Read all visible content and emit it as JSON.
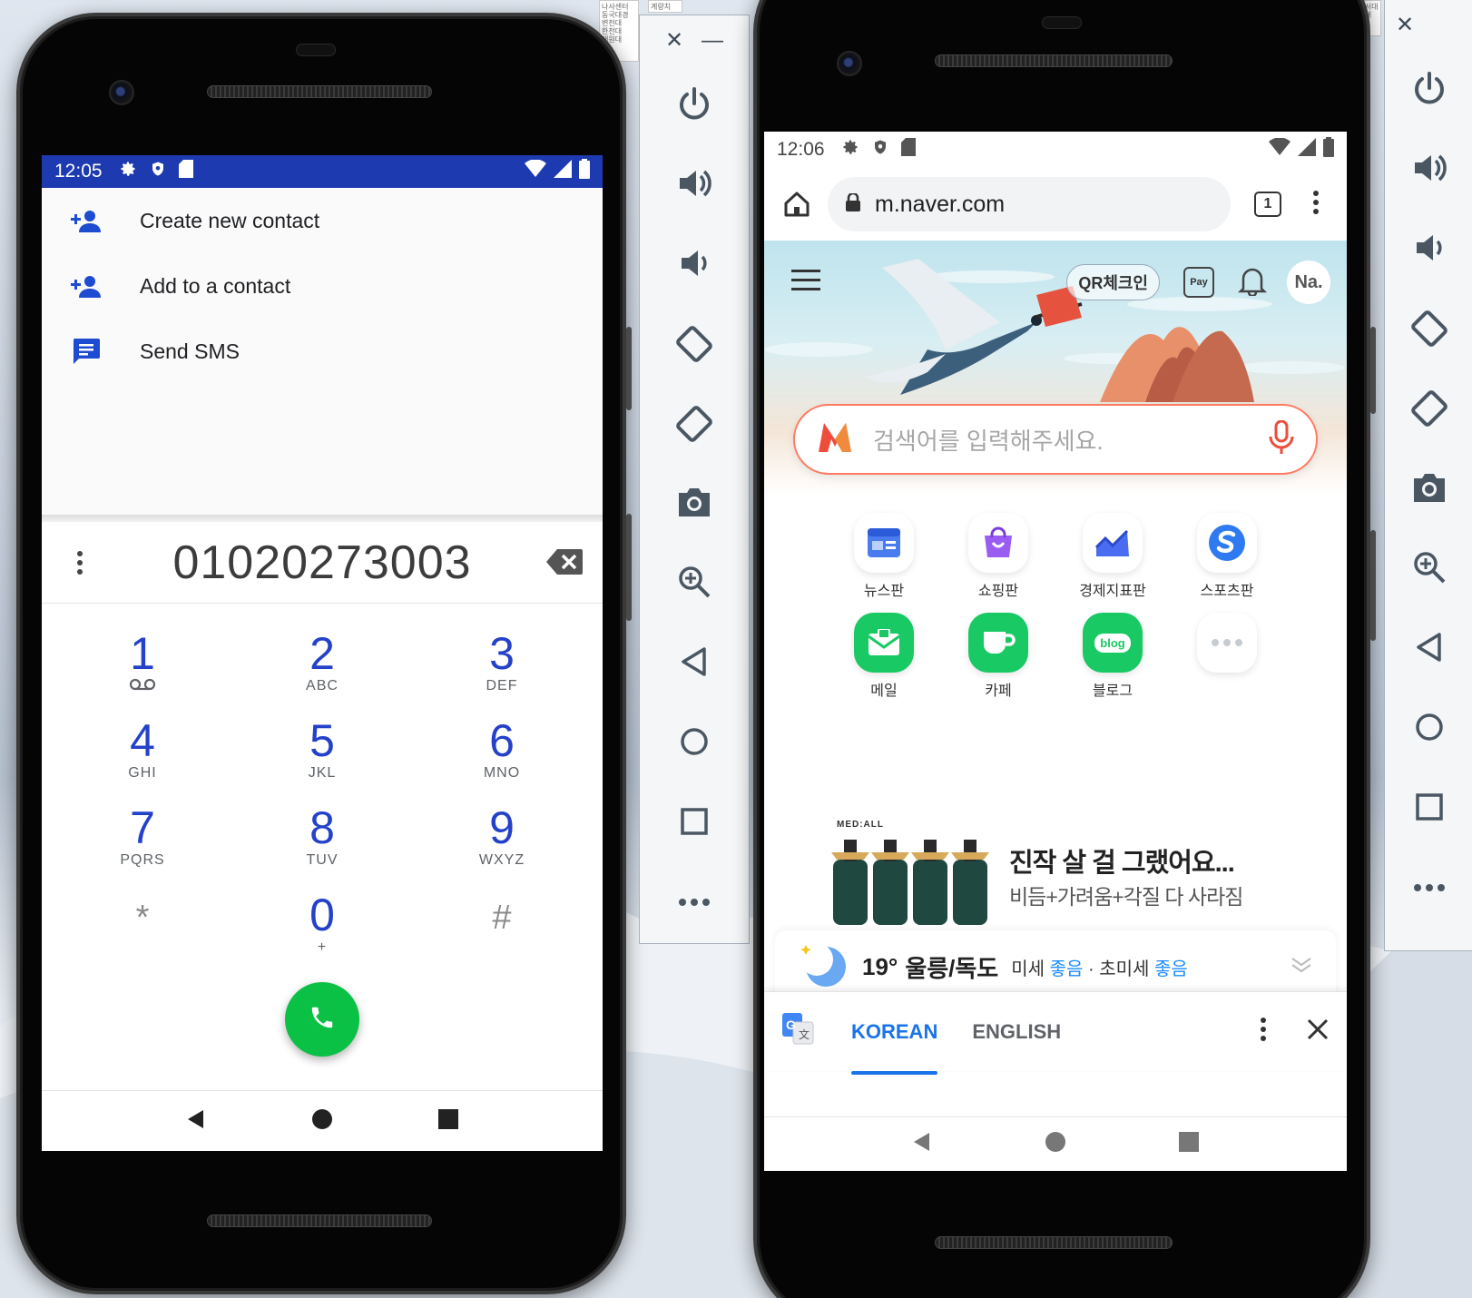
{
  "dialer": {
    "status": {
      "time": "12:05"
    },
    "menu": [
      {
        "label": "Create new contact"
      },
      {
        "label": "Add to a contact"
      },
      {
        "label": "Send SMS"
      }
    ],
    "number": "01020273003",
    "keys": [
      {
        "digit": "1",
        "letters": ""
      },
      {
        "digit": "2",
        "letters": "ABC"
      },
      {
        "digit": "3",
        "letters": "DEF"
      },
      {
        "digit": "4",
        "letters": "GHI"
      },
      {
        "digit": "5",
        "letters": "JKL"
      },
      {
        "digit": "6",
        "letters": "MNO"
      },
      {
        "digit": "7",
        "letters": "PQRS"
      },
      {
        "digit": "8",
        "letters": "TUV"
      },
      {
        "digit": "9",
        "letters": "WXYZ"
      },
      {
        "digit": "*",
        "letters": ""
      },
      {
        "digit": "0",
        "letters": "+"
      },
      {
        "digit": "#",
        "letters": ""
      }
    ],
    "colors": {
      "status_bar": "#1d3ab0",
      "accent": "#2441c9",
      "call": "#0ac145"
    }
  },
  "browser": {
    "status": {
      "time": "12:06"
    },
    "url": "m.naver.com",
    "tab_count": "1",
    "hero": {
      "qr_label": "QR체크인",
      "pay_label": "Pay",
      "avatar_label": "Na.",
      "search_placeholder": "검색어를 입력해주세요."
    },
    "shortcuts": [
      {
        "label": "뉴스판",
        "icon": "news-icon"
      },
      {
        "label": "쇼핑판",
        "icon": "shopping-icon"
      },
      {
        "label": "경제지표판",
        "icon": "economy-chart-icon"
      },
      {
        "label": "스포츠판",
        "icon": "sports-icon"
      },
      {
        "label": "메일",
        "icon": "mail-icon"
      },
      {
        "label": "카페",
        "icon": "cafe-icon"
      },
      {
        "label": "블로그",
        "icon": "blog-icon"
      },
      {
        "label": "",
        "icon": "more-icon"
      }
    ],
    "blog_badge": "blog",
    "ad": {
      "brand": "MED:ALL",
      "headline": "진작 살 걸 그랬어요...",
      "sub": "비듬+가려움+각질 다 사라짐"
    },
    "weather": {
      "temp": "19°",
      "location": "울릉/독도",
      "dust_label": "미세",
      "dust_value": "좋음",
      "separator": "·",
      "fine_dust_label": "초미세",
      "fine_dust_value": "좋음"
    },
    "translate": {
      "tab_active": "KOREAN",
      "tab_inactive": "ENGLISH"
    },
    "colors": {
      "search_border": "#ff7a62",
      "translate_accent": "#1a73e8",
      "good": "#1a8cff"
    }
  },
  "emulator_controls": [
    "power-icon",
    "volume-up-icon",
    "volume-down-icon",
    "rotate-left-icon",
    "rotate-right-icon",
    "screenshot-icon",
    "zoom-icon",
    "back-icon",
    "home-icon",
    "overview-icon",
    "more-icon"
  ],
  "paper_snippets": {
    "left": [
      "나사센터",
      "동국대경",
      "변천대",
      "한천대",
      "대원대"
    ],
    "right": [
      "계량치"
    ],
    "far_right": [
      "기독서대",
      "삼천대"
    ]
  }
}
